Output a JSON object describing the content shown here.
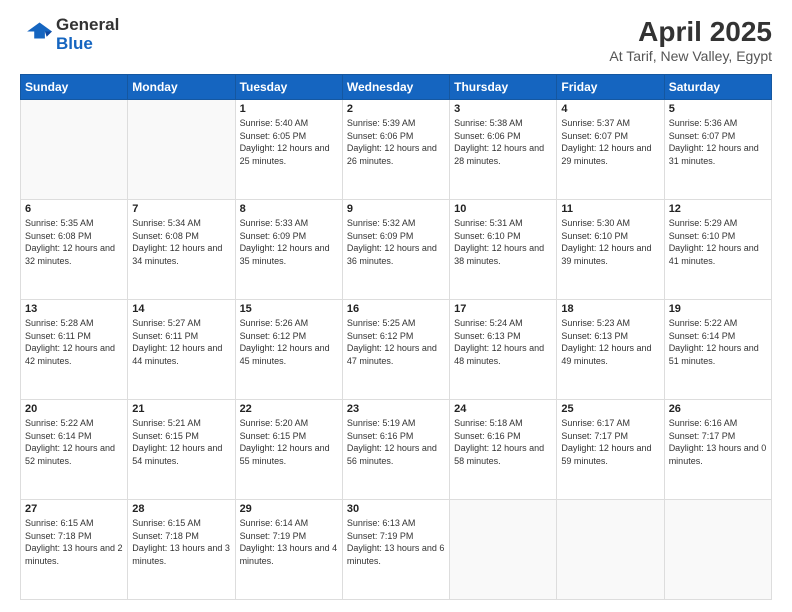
{
  "logo": {
    "general": "General",
    "blue": "Blue"
  },
  "header": {
    "title": "April 2025",
    "subtitle": "At Tarif, New Valley, Egypt"
  },
  "days": [
    "Sunday",
    "Monday",
    "Tuesday",
    "Wednesday",
    "Thursday",
    "Friday",
    "Saturday"
  ],
  "weeks": [
    [
      {
        "day": "",
        "sunrise": "",
        "sunset": "",
        "daylight": ""
      },
      {
        "day": "",
        "sunrise": "",
        "sunset": "",
        "daylight": ""
      },
      {
        "day": "1",
        "sunrise": "Sunrise: 5:40 AM",
        "sunset": "Sunset: 6:05 PM",
        "daylight": "Daylight: 12 hours and 25 minutes."
      },
      {
        "day": "2",
        "sunrise": "Sunrise: 5:39 AM",
        "sunset": "Sunset: 6:06 PM",
        "daylight": "Daylight: 12 hours and 26 minutes."
      },
      {
        "day": "3",
        "sunrise": "Sunrise: 5:38 AM",
        "sunset": "Sunset: 6:06 PM",
        "daylight": "Daylight: 12 hours and 28 minutes."
      },
      {
        "day": "4",
        "sunrise": "Sunrise: 5:37 AM",
        "sunset": "Sunset: 6:07 PM",
        "daylight": "Daylight: 12 hours and 29 minutes."
      },
      {
        "day": "5",
        "sunrise": "Sunrise: 5:36 AM",
        "sunset": "Sunset: 6:07 PM",
        "daylight": "Daylight: 12 hours and 31 minutes."
      }
    ],
    [
      {
        "day": "6",
        "sunrise": "Sunrise: 5:35 AM",
        "sunset": "Sunset: 6:08 PM",
        "daylight": "Daylight: 12 hours and 32 minutes."
      },
      {
        "day": "7",
        "sunrise": "Sunrise: 5:34 AM",
        "sunset": "Sunset: 6:08 PM",
        "daylight": "Daylight: 12 hours and 34 minutes."
      },
      {
        "day": "8",
        "sunrise": "Sunrise: 5:33 AM",
        "sunset": "Sunset: 6:09 PM",
        "daylight": "Daylight: 12 hours and 35 minutes."
      },
      {
        "day": "9",
        "sunrise": "Sunrise: 5:32 AM",
        "sunset": "Sunset: 6:09 PM",
        "daylight": "Daylight: 12 hours and 36 minutes."
      },
      {
        "day": "10",
        "sunrise": "Sunrise: 5:31 AM",
        "sunset": "Sunset: 6:10 PM",
        "daylight": "Daylight: 12 hours and 38 minutes."
      },
      {
        "day": "11",
        "sunrise": "Sunrise: 5:30 AM",
        "sunset": "Sunset: 6:10 PM",
        "daylight": "Daylight: 12 hours and 39 minutes."
      },
      {
        "day": "12",
        "sunrise": "Sunrise: 5:29 AM",
        "sunset": "Sunset: 6:10 PM",
        "daylight": "Daylight: 12 hours and 41 minutes."
      }
    ],
    [
      {
        "day": "13",
        "sunrise": "Sunrise: 5:28 AM",
        "sunset": "Sunset: 6:11 PM",
        "daylight": "Daylight: 12 hours and 42 minutes."
      },
      {
        "day": "14",
        "sunrise": "Sunrise: 5:27 AM",
        "sunset": "Sunset: 6:11 PM",
        "daylight": "Daylight: 12 hours and 44 minutes."
      },
      {
        "day": "15",
        "sunrise": "Sunrise: 5:26 AM",
        "sunset": "Sunset: 6:12 PM",
        "daylight": "Daylight: 12 hours and 45 minutes."
      },
      {
        "day": "16",
        "sunrise": "Sunrise: 5:25 AM",
        "sunset": "Sunset: 6:12 PM",
        "daylight": "Daylight: 12 hours and 47 minutes."
      },
      {
        "day": "17",
        "sunrise": "Sunrise: 5:24 AM",
        "sunset": "Sunset: 6:13 PM",
        "daylight": "Daylight: 12 hours and 48 minutes."
      },
      {
        "day": "18",
        "sunrise": "Sunrise: 5:23 AM",
        "sunset": "Sunset: 6:13 PM",
        "daylight": "Daylight: 12 hours and 49 minutes."
      },
      {
        "day": "19",
        "sunrise": "Sunrise: 5:22 AM",
        "sunset": "Sunset: 6:14 PM",
        "daylight": "Daylight: 12 hours and 51 minutes."
      }
    ],
    [
      {
        "day": "20",
        "sunrise": "Sunrise: 5:22 AM",
        "sunset": "Sunset: 6:14 PM",
        "daylight": "Daylight: 12 hours and 52 minutes."
      },
      {
        "day": "21",
        "sunrise": "Sunrise: 5:21 AM",
        "sunset": "Sunset: 6:15 PM",
        "daylight": "Daylight: 12 hours and 54 minutes."
      },
      {
        "day": "22",
        "sunrise": "Sunrise: 5:20 AM",
        "sunset": "Sunset: 6:15 PM",
        "daylight": "Daylight: 12 hours and 55 minutes."
      },
      {
        "day": "23",
        "sunrise": "Sunrise: 5:19 AM",
        "sunset": "Sunset: 6:16 PM",
        "daylight": "Daylight: 12 hours and 56 minutes."
      },
      {
        "day": "24",
        "sunrise": "Sunrise: 5:18 AM",
        "sunset": "Sunset: 6:16 PM",
        "daylight": "Daylight: 12 hours and 58 minutes."
      },
      {
        "day": "25",
        "sunrise": "Sunrise: 6:17 AM",
        "sunset": "Sunset: 7:17 PM",
        "daylight": "Daylight: 12 hours and 59 minutes."
      },
      {
        "day": "26",
        "sunrise": "Sunrise: 6:16 AM",
        "sunset": "Sunset: 7:17 PM",
        "daylight": "Daylight: 13 hours and 0 minutes."
      }
    ],
    [
      {
        "day": "27",
        "sunrise": "Sunrise: 6:15 AM",
        "sunset": "Sunset: 7:18 PM",
        "daylight": "Daylight: 13 hours and 2 minutes."
      },
      {
        "day": "28",
        "sunrise": "Sunrise: 6:15 AM",
        "sunset": "Sunset: 7:18 PM",
        "daylight": "Daylight: 13 hours and 3 minutes."
      },
      {
        "day": "29",
        "sunrise": "Sunrise: 6:14 AM",
        "sunset": "Sunset: 7:19 PM",
        "daylight": "Daylight: 13 hours and 4 minutes."
      },
      {
        "day": "30",
        "sunrise": "Sunrise: 6:13 AM",
        "sunset": "Sunset: 7:19 PM",
        "daylight": "Daylight: 13 hours and 6 minutes."
      },
      {
        "day": "",
        "sunrise": "",
        "sunset": "",
        "daylight": ""
      },
      {
        "day": "",
        "sunrise": "",
        "sunset": "",
        "daylight": ""
      },
      {
        "day": "",
        "sunrise": "",
        "sunset": "",
        "daylight": ""
      }
    ]
  ]
}
